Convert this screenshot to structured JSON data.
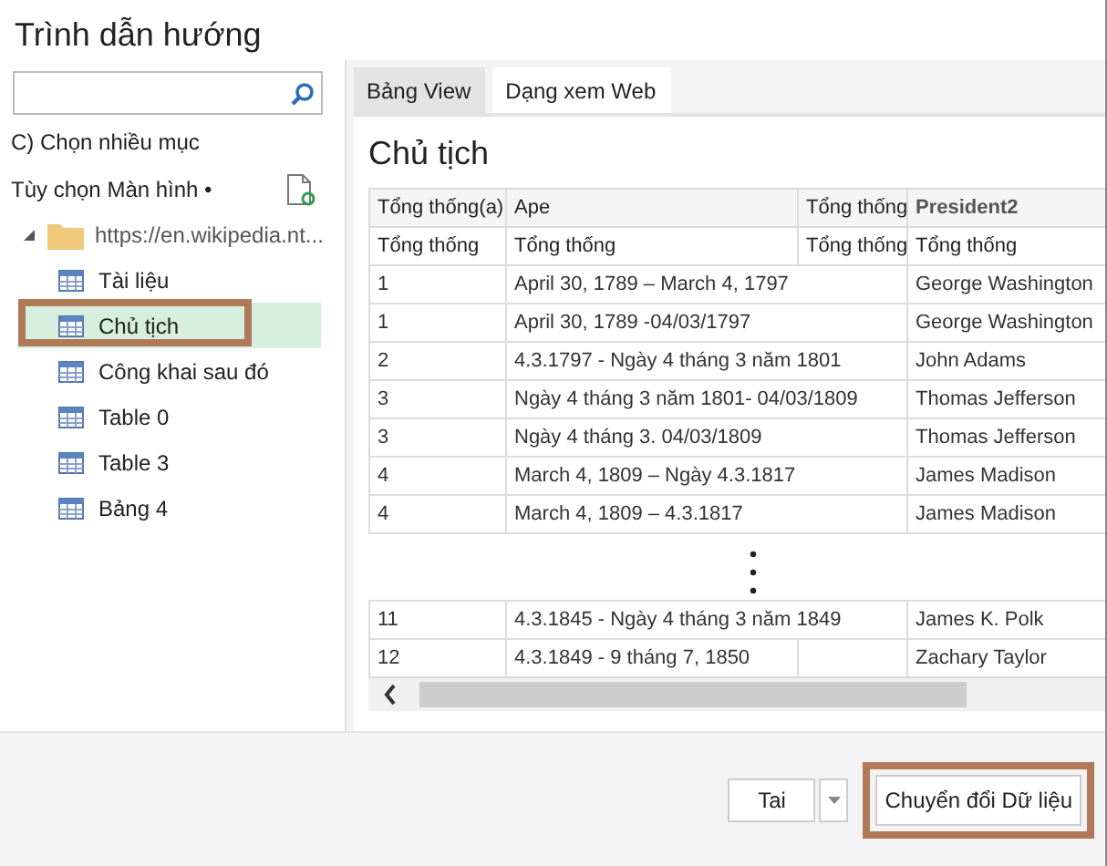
{
  "window": {
    "title": "Trình dẫn hướng"
  },
  "sidebar": {
    "multi_select": "C) Chọn nhiều mục",
    "display_options": "Tùy chọn Màn hình •",
    "tree": [
      {
        "label": "https://en.wikipedia.nt...",
        "expanded": true,
        "children": [
          {
            "label": "Tài liệu",
            "selected": false
          },
          {
            "label": "Chủ tịch",
            "selected": true
          },
          {
            "label": "Công khai sau đó",
            "selected": false
          },
          {
            "label": "Table 0",
            "selected": false
          },
          {
            "label": "Table 3",
            "selected": false
          },
          {
            "label": "Bảng 4",
            "selected": false
          }
        ]
      }
    ]
  },
  "tabs": [
    {
      "label": "Bảng View",
      "selected": true
    },
    {
      "label": "Dạng xem Web",
      "selected": false
    }
  ],
  "preview": {
    "title": "Chủ tịch",
    "table": {
      "columns": [
        "Tổng thống(a)",
        "Ape",
        "Tổng thống",
        "President2"
      ],
      "subheader": [
        "Tổng thống",
        "Tổng thống",
        "Tổng thống",
        "Tổng thống"
      ],
      "rows": [
        {
          "cells": [
            "1",
            "April 30, 1789 – March 4, 1797",
            "George Washington"
          ]
        },
        {
          "cells": [
            "1",
            "April 30, 1789 -04/03/1797",
            "George Washington"
          ]
        },
        {
          "cells": [
            "2",
            "4.3.1797 -   Ngày 4 tháng 3 năm 1801",
            "John Adams"
          ]
        },
        {
          "cells": [
            "3",
            "Ngày 4 tháng 3 năm 1801-   04/03/1809",
            "Thomas Jefferson"
          ]
        },
        {
          "cells": [
            "3",
            "Ngày 4 tháng 3.   04/03/1809",
            "Thomas Jefferson"
          ]
        },
        {
          "cells": [
            "4",
            "March 4, 1809 – Ngày 4.3.1817",
            "James Madison"
          ]
        },
        {
          "cells": [
            "4",
            "March 4, 1809   – 4.3.1817",
            "James Madison"
          ]
        },
        {
          "kind": "gap"
        },
        {
          "cells": [
            "11",
            "4.3.1845 -   Ngày 4 tháng 3 năm 1849",
            "James K. Polk"
          ]
        },
        {
          "cells": [
            "12",
            "4.3.1849 - 9 tháng 7, 1850",
            null,
            "Zachary Taylor"
          ]
        }
      ]
    }
  },
  "footer": {
    "load": "Tai",
    "transform": "Chuyển đổi Dữ liệu"
  }
}
